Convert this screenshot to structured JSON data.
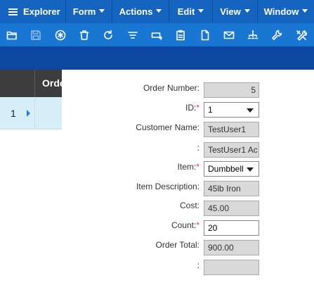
{
  "menubar": {
    "explorer_label": "Explorer",
    "menus": [
      {
        "label": "Form"
      },
      {
        "label": "Actions"
      },
      {
        "label": "Edit"
      },
      {
        "label": "View"
      },
      {
        "label": "Window"
      }
    ]
  },
  "toolbar": {
    "icons": [
      "folder-open-icon",
      "save-icon",
      "asterisk-icon",
      "trash-icon",
      "refresh-icon",
      "filter-icon",
      "add-row-icon",
      "clipboard-icon",
      "document-icon",
      "mail-icon",
      "hierarchy-icon",
      "wrench-icon",
      "tools-icon"
    ],
    "disabled": [
      "save-icon"
    ]
  },
  "grid": {
    "column_header": "Orde",
    "rows": [
      {
        "number": "1"
      }
    ]
  },
  "form": {
    "order_number": {
      "label": "Order Number:",
      "value": "5"
    },
    "id": {
      "label": "ID:",
      "required_mark": "*",
      "value": "1"
    },
    "customer_name": {
      "label": "Customer Name:",
      "value": "TestUser1"
    },
    "customer_extra": {
      "label": ":",
      "value": "TestUser1  Ac"
    },
    "item": {
      "label": "Item:",
      "required_mark": "*",
      "value": "Dumbbell"
    },
    "item_description": {
      "label": "Item Description:",
      "value": "45lb Iron"
    },
    "cost": {
      "label": "Cost:",
      "value": "45.00"
    },
    "count": {
      "label": "Count:",
      "required_mark": "*",
      "value": "20"
    },
    "order_total": {
      "label": "Order Total:",
      "value": "900.00"
    },
    "blank": {
      "label": ":",
      "value": ""
    }
  }
}
